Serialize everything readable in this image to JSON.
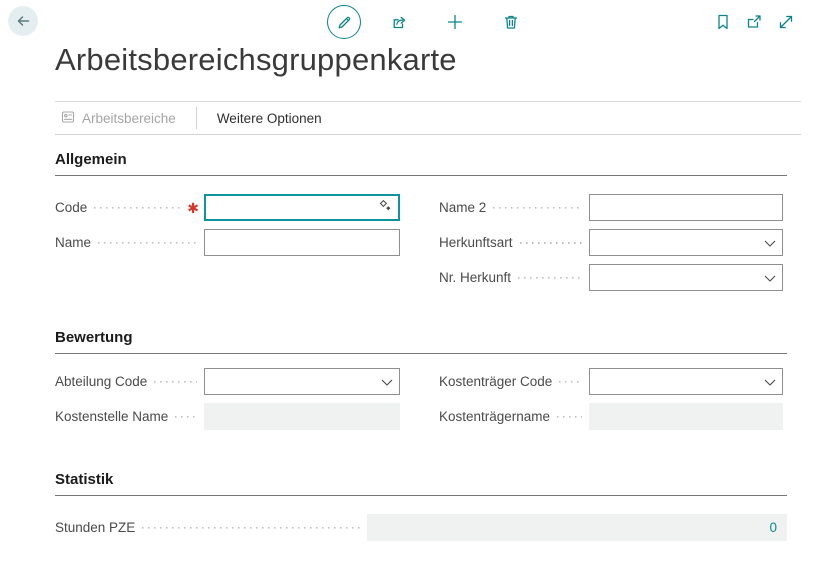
{
  "colors": {
    "accent": "#0b858d",
    "required": "#d83428",
    "disabled_bg": "#f0f2f2",
    "focus_border": "#0e949c",
    "drill_value": "#0a8a93"
  },
  "header": {
    "title": "Arbeitsbereichsgruppenkarte",
    "toolbar_icons": [
      "pencil",
      "share",
      "plus",
      "trash"
    ],
    "window_icons": [
      "bookmark",
      "popout",
      "expand"
    ]
  },
  "menubar": {
    "items": [
      {
        "label": "Arbeitsbereiche",
        "enabled": false
      },
      {
        "label": "Weitere Optionen",
        "enabled": true
      }
    ]
  },
  "form": {
    "required_marker": "✱",
    "sections": {
      "allgemein": {
        "title": "Allgemein",
        "fields": {
          "code": {
            "label": "Code",
            "value": "",
            "required": true
          },
          "name": {
            "label": "Name",
            "value": ""
          },
          "name2": {
            "label": "Name 2",
            "value": ""
          },
          "herkunftsart": {
            "label": "Herkunftsart",
            "value": "",
            "type": "dropdown"
          },
          "nr_herkunft": {
            "label": "Nr. Herkunft",
            "value": "",
            "type": "dropdown"
          }
        }
      },
      "bewertung": {
        "title": "Bewertung",
        "fields": {
          "abteilung_code": {
            "label": "Abteilung Code",
            "value": "",
            "type": "dropdown"
          },
          "kostenstelle_name": {
            "label": "Kostenstelle Name",
            "value": "",
            "disabled": true
          },
          "kostentraeger_code": {
            "label": "Kostenträger Code",
            "value": "",
            "type": "dropdown"
          },
          "kostentraegername": {
            "label": "Kostenträgername",
            "value": "",
            "disabled": true
          }
        }
      },
      "statistik": {
        "title": "Statistik",
        "fields": {
          "stunden_pze": {
            "label": "Stunden PZE",
            "value": "0",
            "disabled": true
          }
        }
      }
    }
  }
}
